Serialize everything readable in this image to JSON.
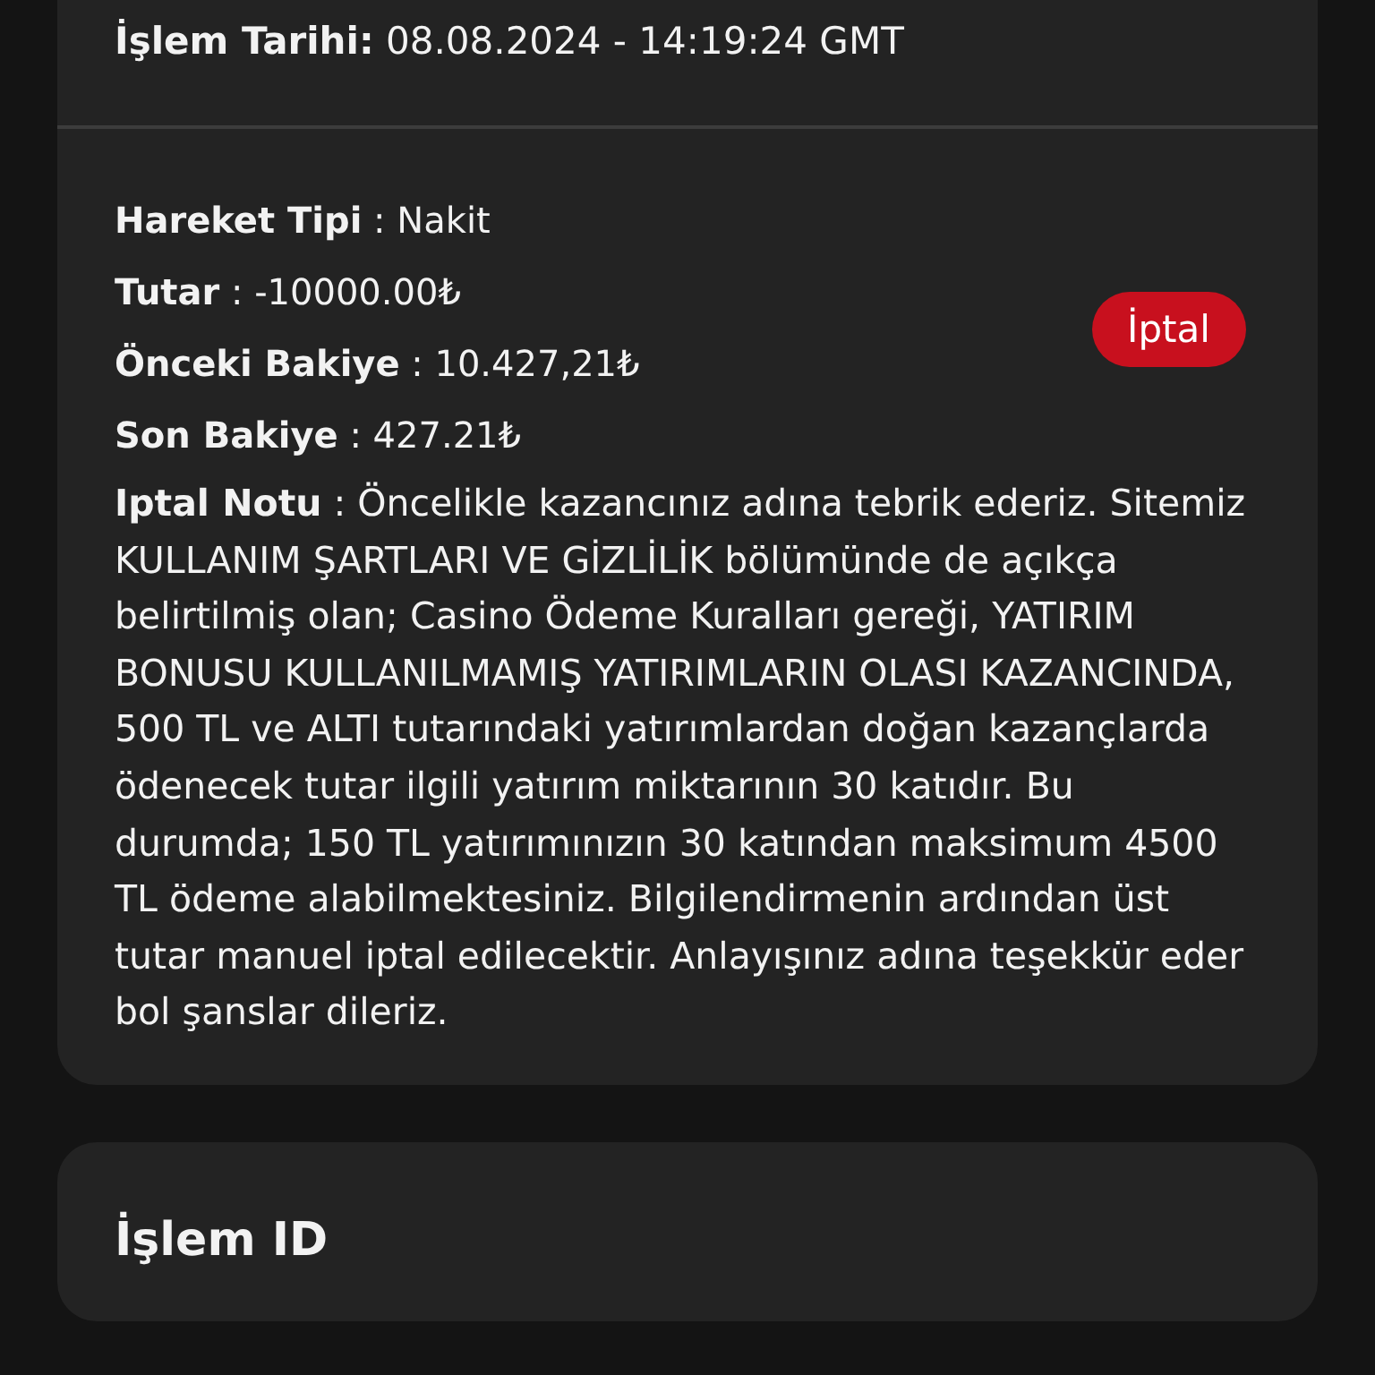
{
  "transaction_card": {
    "date": {
      "label": "İşlem Tarihi:",
      "value": "08.08.2024 - 14:19:24 GMT"
    },
    "details": [
      {
        "label": "Hareket Tipi",
        "value": ": Nakit"
      },
      {
        "label": "Tutar",
        "value": ": -10000.00₺"
      },
      {
        "label": "Önceki Bakiye",
        "value": ": 10.427,21₺"
      },
      {
        "label": "Son Bakiye",
        "value": ": 427.21₺"
      }
    ],
    "status": {
      "text": "İptal",
      "kind": "cancelled"
    },
    "note": {
      "label": "Iptal Notu",
      "text": ": Öncelikle kazancınız adına tebrik ederiz. Sitemiz KULLANIM ŞARTLARI VE GİZLİLİK bölümünde de açıkça belirtilmiş olan; Casino Ödeme Kuralları gereği, YATIRIM BONUSU KULLANILMAMIŞ YATIRIMLARIN OLASI KAZANCINDA, 500 TL ve ALTI tutarındaki yatırımlardan doğan kazançlarda ödenecek tutar ilgili yatırım miktarının 30 katıdır. Bu durumda; 150 TL yatırımınızın 30 katından maksimum 4500 TL ödeme alabilmektesiniz. Bilgilendirmenin ardından üst tutar manuel iptal edilecektir. Anlayışınız adına teşekkür eder bol şanslar dileriz."
    }
  },
  "id_card": {
    "title": "İşlem ID"
  }
}
